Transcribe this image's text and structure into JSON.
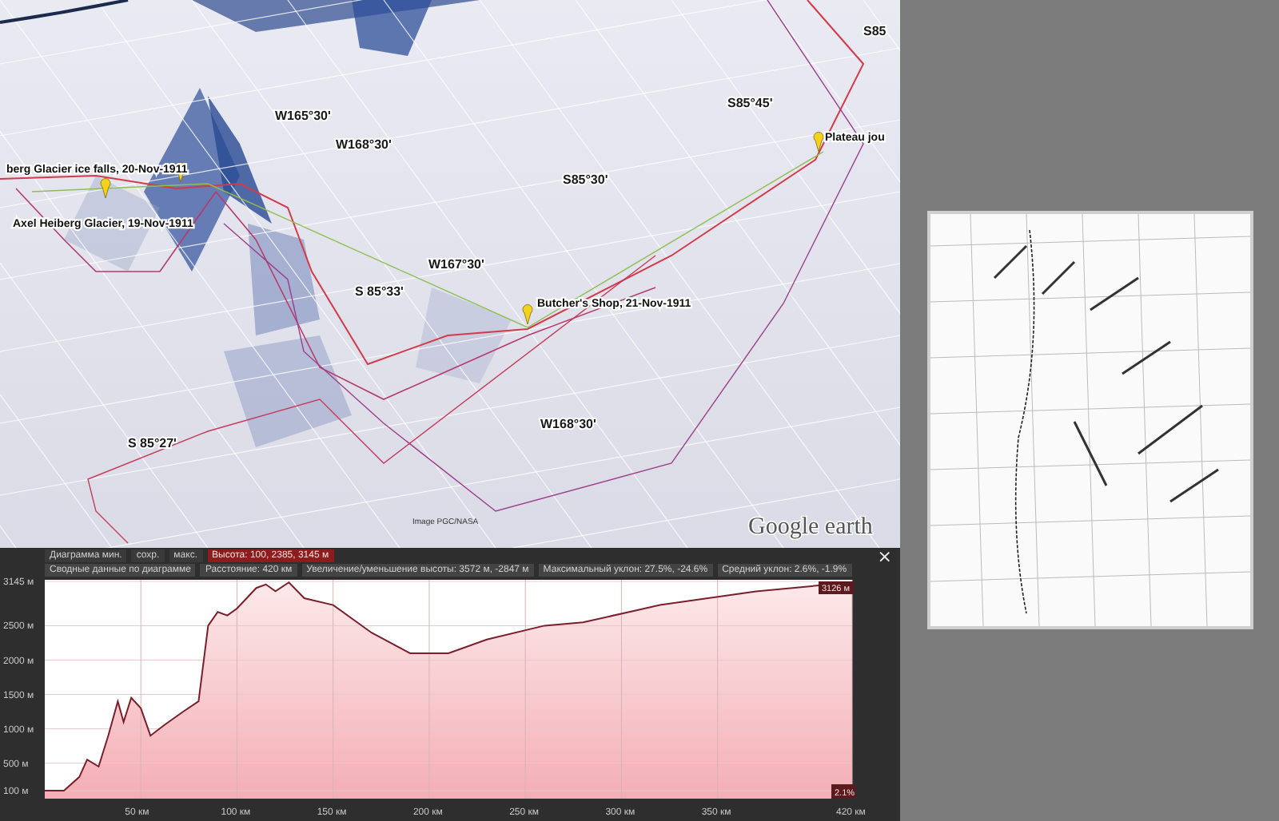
{
  "map_view": {
    "labels": [
      {
        "kind": "coordinate",
        "text": "S85"
      },
      {
        "kind": "coordinate",
        "text": "W165°30'"
      },
      {
        "kind": "coordinate",
        "text": "W168°30'"
      },
      {
        "kind": "coordinate",
        "text": "S85°45'"
      },
      {
        "kind": "placemark",
        "text": "Plateau jou"
      },
      {
        "kind": "coordinate",
        "text": "S85°30'"
      },
      {
        "kind": "placemark",
        "text": "berg Glacier ice falls, 20-Nov-1911"
      },
      {
        "kind": "placemark",
        "text": "Axel Heiberg Glacier, 19-Nov-1911"
      },
      {
        "kind": "coordinate",
        "text": "W167°30'"
      },
      {
        "kind": "coordinate",
        "text": "S 85°33'"
      },
      {
        "kind": "placemark",
        "text": "Butcher's Shop, 21-Nov-1911"
      },
      {
        "kind": "coordinate",
        "text": "W168°30'"
      },
      {
        "kind": "coordinate",
        "text": "S 85°27'"
      }
    ],
    "attribution": "Image PGC/NASA",
    "logo": "Google earth"
  },
  "elevation_profile": {
    "toolbar": [
      {
        "kind": "plain",
        "text": "Диаграмма мин."
      },
      {
        "kind": "plain",
        "text": "сохр."
      },
      {
        "kind": "plain",
        "text": "макс."
      },
      {
        "kind": "highlight",
        "text": "Высота: 100, 2385, 3145 м"
      }
    ],
    "summary": [
      "Сводные данные по диаграмме",
      "Расстояние: 420 км",
      "Увеличение/уменьшение высоты: 3572 м, -2847 м",
      "Максимальный уклон: 27.5%, -24.6%",
      "Средний уклон: 2.6%, -1.9%"
    ],
    "close": "×",
    "current_value": "3126 м",
    "current_slope": "2.1%",
    "chart_data": {
      "type": "area",
      "x": [
        0,
        10,
        18,
        22,
        28,
        33,
        38,
        41,
        45,
        50,
        55,
        62,
        72,
        80,
        85,
        90,
        95,
        100,
        110,
        115,
        120,
        127,
        135,
        150,
        170,
        190,
        210,
        230,
        260,
        280,
        320,
        370,
        420
      ],
      "series": [
        {
          "color": "#7a1f2a",
          "values": [
            100,
            100,
            300,
            550,
            450,
            900,
            1400,
            1100,
            1450,
            1300,
            900,
            1050,
            1250,
            1400,
            2500,
            2700,
            2650,
            2750,
            3050,
            3100,
            3000,
            3130,
            2900,
            2800,
            2400,
            2100,
            2100,
            2300,
            2500,
            2550,
            2800,
            3000,
            3130
          ]
        }
      ],
      "grid": true,
      "xlim": [
        0,
        420
      ],
      "ylim": [
        100,
        3145
      ],
      "xticks": [
        {
          "value": 50,
          "label": "50 км"
        },
        {
          "value": 100,
          "label": "100 км"
        },
        {
          "value": 150,
          "label": "150 км"
        },
        {
          "value": 200,
          "label": "200 км"
        },
        {
          "value": 250,
          "label": "250 км"
        },
        {
          "value": 300,
          "label": "300 км"
        },
        {
          "value": 350,
          "label": "350 км"
        },
        {
          "value": 420,
          "label": "420 км"
        }
      ],
      "yticks": [
        {
          "value": 100,
          "label": "100 м"
        },
        {
          "value": 500,
          "label": "500 м"
        },
        {
          "value": 1000,
          "label": "1000 м"
        },
        {
          "value": 1500,
          "label": "1500 м"
        },
        {
          "value": 2000,
          "label": "2000 м"
        },
        {
          "value": 2500,
          "label": "2500 м"
        },
        {
          "value": 3145,
          "label": "3145 м"
        }
      ]
    }
  }
}
